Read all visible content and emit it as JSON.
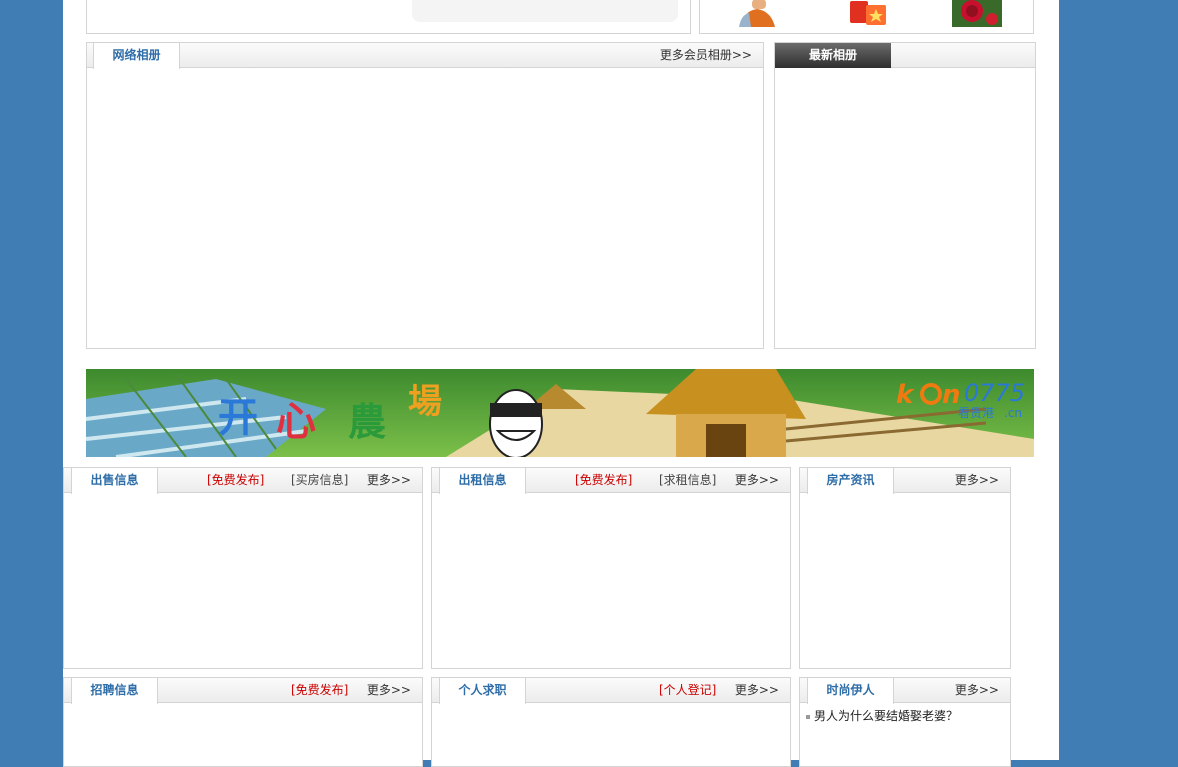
{
  "top": {},
  "albums": {
    "network_tab": "网络相册",
    "more_label": "更多会员相册>>",
    "latest_tab": "最新相册"
  },
  "banner": {
    "title": "开心農場",
    "logo_text": "0775",
    "logo_sub": "看贵港",
    "logo_domain": ".cn"
  },
  "row1": {
    "sale": {
      "tab": "出售信息",
      "free": "[免费发布]",
      "link": "[买房信息]",
      "more": "更多>>"
    },
    "rent": {
      "tab": "出租信息",
      "free": "[免费发布]",
      "link": "[求租信息]",
      "more": "更多>>"
    },
    "property": {
      "tab": "房产资讯",
      "more": "更多>>"
    }
  },
  "row2": {
    "jobs": {
      "tab": "招聘信息",
      "free": "[免费发布]",
      "more": "更多>>"
    },
    "seek": {
      "tab": "个人求职",
      "register": "[个人登记]",
      "more": "更多>>"
    },
    "fashion": {
      "tab": "时尚伊人",
      "more": "更多>>",
      "items": [
        "男人为什么要结婚娶老婆？"
      ]
    }
  },
  "colors": {
    "background": "#3f7db4",
    "accent": "#2f6ea8",
    "red": "#cc0000"
  }
}
